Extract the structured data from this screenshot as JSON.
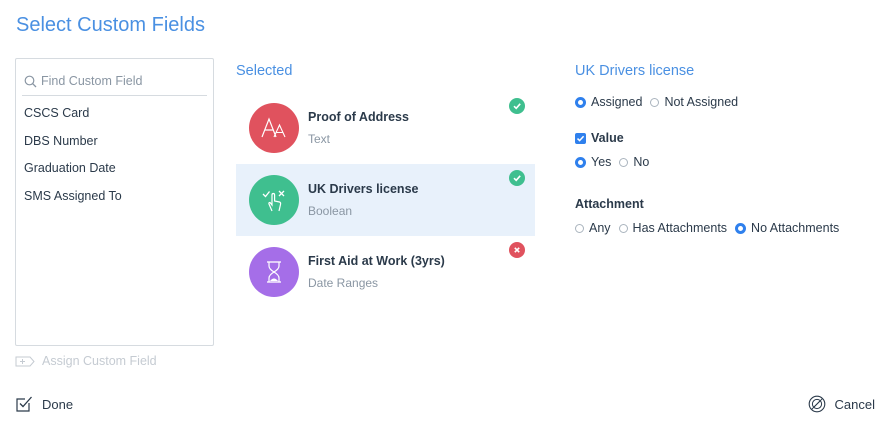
{
  "dialog": {
    "title": "Select Custom Fields"
  },
  "search": {
    "placeholder": "Find Custom Field",
    "value": ""
  },
  "available_fields": [
    "CSCS Card",
    "DBS Number",
    "Graduation Date",
    "SMS Assigned To"
  ],
  "assign_button": "Assign Custom Field",
  "selected": {
    "heading": "Selected",
    "items": [
      {
        "name": "Proof of Address",
        "type": "Text",
        "icon": "text-icon",
        "color": "#e0525e",
        "status": "valid",
        "active": false
      },
      {
        "name": "UK Drivers license",
        "type": "Boolean",
        "icon": "touch-check-icon",
        "color": "#3fbf8f",
        "status": "valid",
        "active": true
      },
      {
        "name": "First Aid at Work (3yrs)",
        "type": "Date Ranges",
        "icon": "hourglass-icon",
        "color": "#a56ee8",
        "status": "invalid",
        "active": false
      }
    ]
  },
  "detail": {
    "title": "UK Drivers license",
    "assignment": {
      "options": [
        "Assigned",
        "Not Assigned"
      ],
      "selected": "Assigned"
    },
    "value": {
      "label": "Value",
      "checked": true,
      "options": [
        "Yes",
        "No"
      ],
      "selected": "Yes"
    },
    "attachment": {
      "label": "Attachment",
      "options": [
        "Any",
        "Has Attachments",
        "No Attachments"
      ],
      "selected": "No Attachments"
    }
  },
  "footer": {
    "done": "Done",
    "cancel": "Cancel"
  },
  "colors": {
    "accent": "#4a90e2",
    "radio": "#2f80ed",
    "valid": "#3fbf8f",
    "invalid": "#e0525e",
    "active_row": "#e8f1fb"
  }
}
